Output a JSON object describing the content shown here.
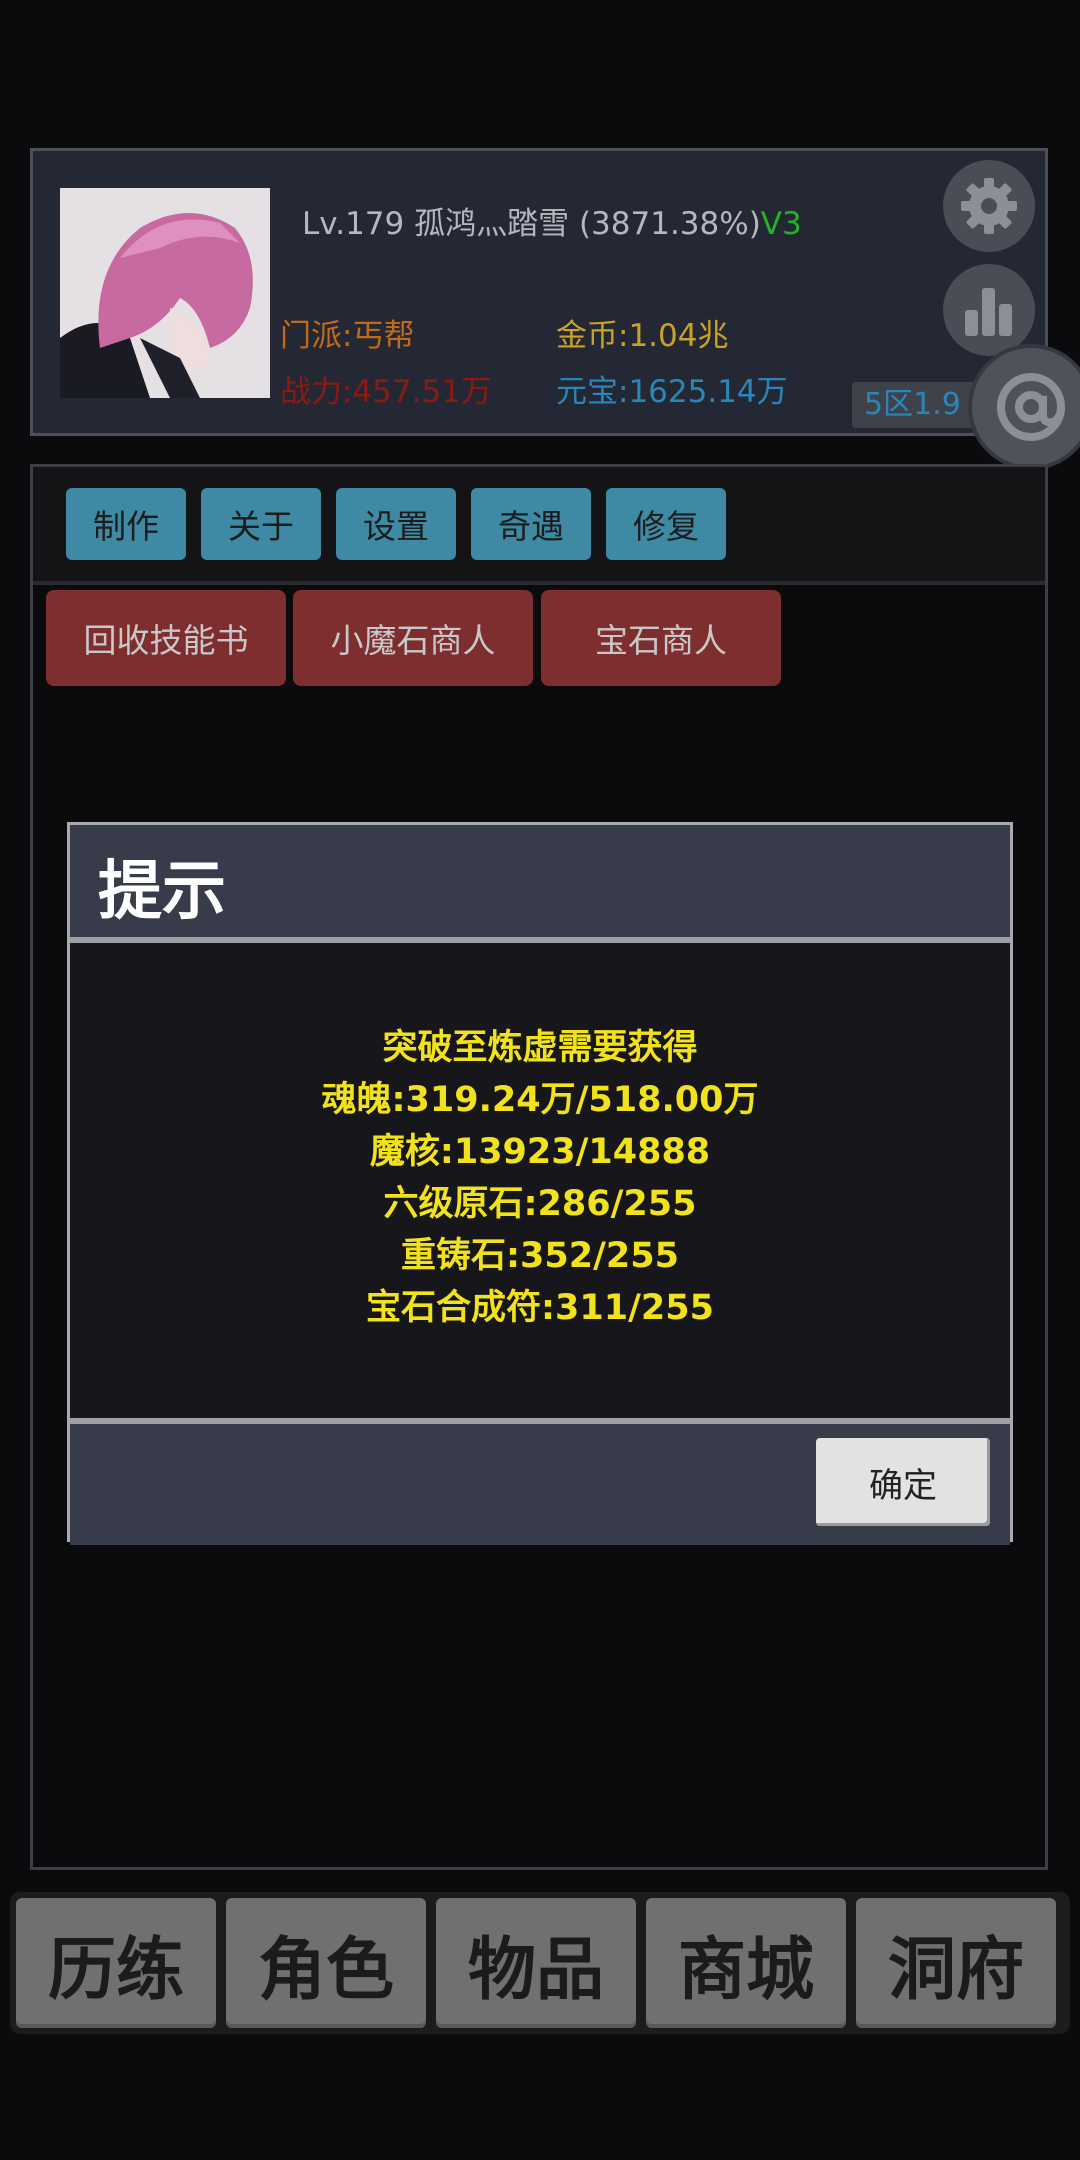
{
  "player": {
    "level_name": "Lv.179 孤鸿灬踏雪",
    "exp_percent": "(3871.38%)",
    "vip": "V3",
    "sect": "门派:丐帮",
    "gold": "金币:1.04兆",
    "power": "战力:457.51万",
    "ingot": "元宝:1625.14万",
    "server": "5区1.9"
  },
  "toolbar": [
    "制作",
    "关于",
    "设置",
    "奇遇",
    "修复"
  ],
  "merchants": [
    "回收技能书",
    "小魔石商人",
    "宝石商人"
  ],
  "dialog": {
    "title": "提示",
    "lines": [
      "突破至炼虚需要获得",
      "魂魄:319.24万/518.00万",
      "魔核:13923/14888",
      "六级原石:286/255",
      "重铸石:352/255",
      "宝石合成符:311/255"
    ],
    "ok_label": "确定"
  },
  "nav": [
    "历练",
    "角色",
    "物品",
    "商城",
    "洞府"
  ],
  "icons": {
    "settings": "gear-icon",
    "rank": "bar-chart-icon",
    "chat": "at-sign-icon"
  }
}
